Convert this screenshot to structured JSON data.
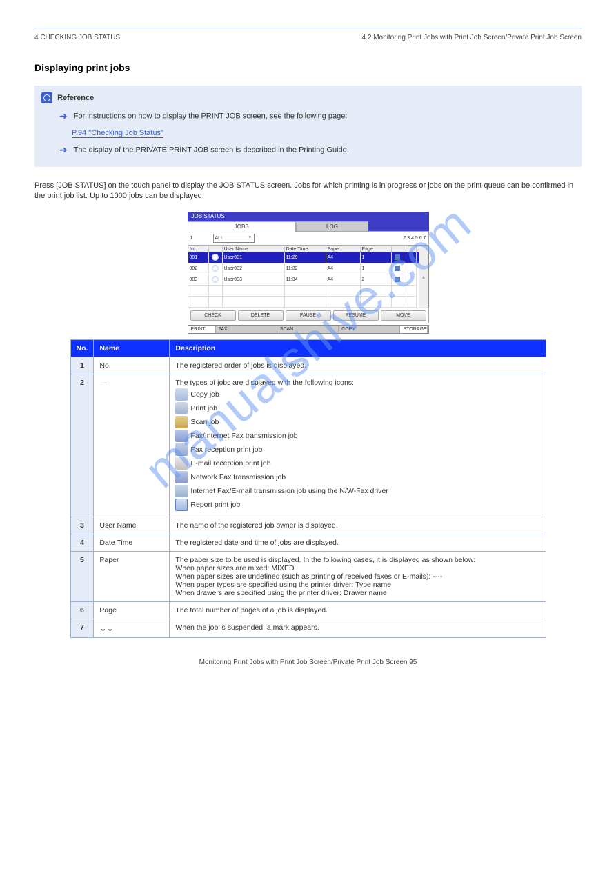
{
  "header": {
    "left": "4 CHECKING JOB STATUS",
    "right": "4.2 Monitoring Print Jobs with Print Job Screen/Private Print Job Screen"
  },
  "section_title": "Displaying print jobs",
  "note": {
    "label": "Reference",
    "line1_prefix": "For instructions on how to display the PRINT JOB screen, see the following page:",
    "link": "P.94 \"Checking Job Status\"",
    "line2": "The display of the PRIVATE PRINT JOB screen is described in the Printing Guide."
  },
  "paragraph": "Press [JOB STATUS] on the touch panel to display the JOB STATUS screen. Jobs for which printing is in progress or jobs on the print queue can be confirmed in the print job list. Up to 1000 jobs can be displayed.",
  "screenshot": {
    "title": "JOB STATUS",
    "tab_active": "JOBS",
    "tab_inactive": "LOG",
    "dropdown": "ALL",
    "cols": {
      "c1": "No.",
      "c2": "",
      "c3": "User Name",
      "c4": "Date Time",
      "c5": "Paper",
      "c6": "Page",
      "c7": "",
      "c8": ""
    },
    "rows": [
      {
        "no": "001",
        "user": "User001",
        "dt": "11:29",
        "paper": "A4",
        "page": "1",
        "save": true,
        "hand": true,
        "selected": true
      },
      {
        "no": "002",
        "user": "User002",
        "dt": "11:32",
        "paper": "A4",
        "page": "1",
        "save": true,
        "hand": true,
        "selected": false
      },
      {
        "no": "003",
        "user": "User003",
        "dt": "11:34",
        "paper": "A4",
        "page": "2",
        "save": true,
        "hand": true,
        "selected": false
      },
      {
        "no": "",
        "user": "",
        "dt": "",
        "paper": "",
        "page": "",
        "save": false,
        "hand": false,
        "selected": false
      },
      {
        "no": "",
        "user": "",
        "dt": "",
        "paper": "",
        "page": "",
        "save": false,
        "hand": false,
        "selected": false
      }
    ],
    "buttons": [
      "CHECK",
      "DELETE",
      "PAUSE",
      "RESUME",
      "MOVE"
    ],
    "status": [
      "PRINT",
      "FAX",
      "SCAN",
      "COPY",
      "STORAGE"
    ]
  },
  "table": {
    "head": {
      "no": "No.",
      "name": "Name",
      "desc": "Description"
    },
    "rows": [
      {
        "num": "1",
        "name": "No.",
        "desc": "The registered order of jobs is displayed."
      },
      {
        "num": "2",
        "name": "—",
        "desc_pre": "The types of jobs are displayed with the following icons:",
        "icons": [
          {
            "class": "ic-copy",
            "label": "Copy job"
          },
          {
            "class": "ic-print",
            "label": "Print job"
          },
          {
            "class": "ic-scan",
            "label": "Scan job"
          },
          {
            "class": "ic-fax",
            "label": "Fax/Internet Fax transmission job"
          },
          {
            "class": "ic-ifax",
            "label": "Fax reception print job"
          },
          {
            "class": "ic-email",
            "label": "E-mail reception print job"
          },
          {
            "class": "ic-net",
            "label": "Network Fax transmission job"
          },
          {
            "class": "ic-monitor",
            "label": "Internet Fax/E-mail transmission job using the N/W-Fax driver"
          },
          {
            "class": "ic-report",
            "label": "Report print job"
          }
        ]
      },
      {
        "num": "3",
        "name": "User Name",
        "desc": "The name of the registered job owner is displayed."
      },
      {
        "num": "4",
        "name": "Date Time",
        "desc": "The registered date and time of jobs are displayed."
      },
      {
        "num": "5",
        "name": "Paper",
        "desc_multi": [
          "The paper size to be used is displayed. In the following cases, it is displayed as shown below:",
          "When paper sizes are mixed: MIXED",
          "When paper sizes are undefined (such as printing of received faxes or E-mails): ----",
          "When paper types are specified using the printer driver: Type name",
          "When drawers are specified using the printer driver: Drawer name"
        ]
      },
      {
        "num": "6",
        "name": "Page",
        "desc": "The total number of pages of a job is displayed."
      },
      {
        "num": "7",
        "name_chev": true,
        "desc": "When the job is suspended, a mark appears."
      }
    ]
  },
  "footer": "Monitoring Print Jobs with Print Job Screen/Private Print Job Screen    95",
  "watermark": "manualshive.com"
}
